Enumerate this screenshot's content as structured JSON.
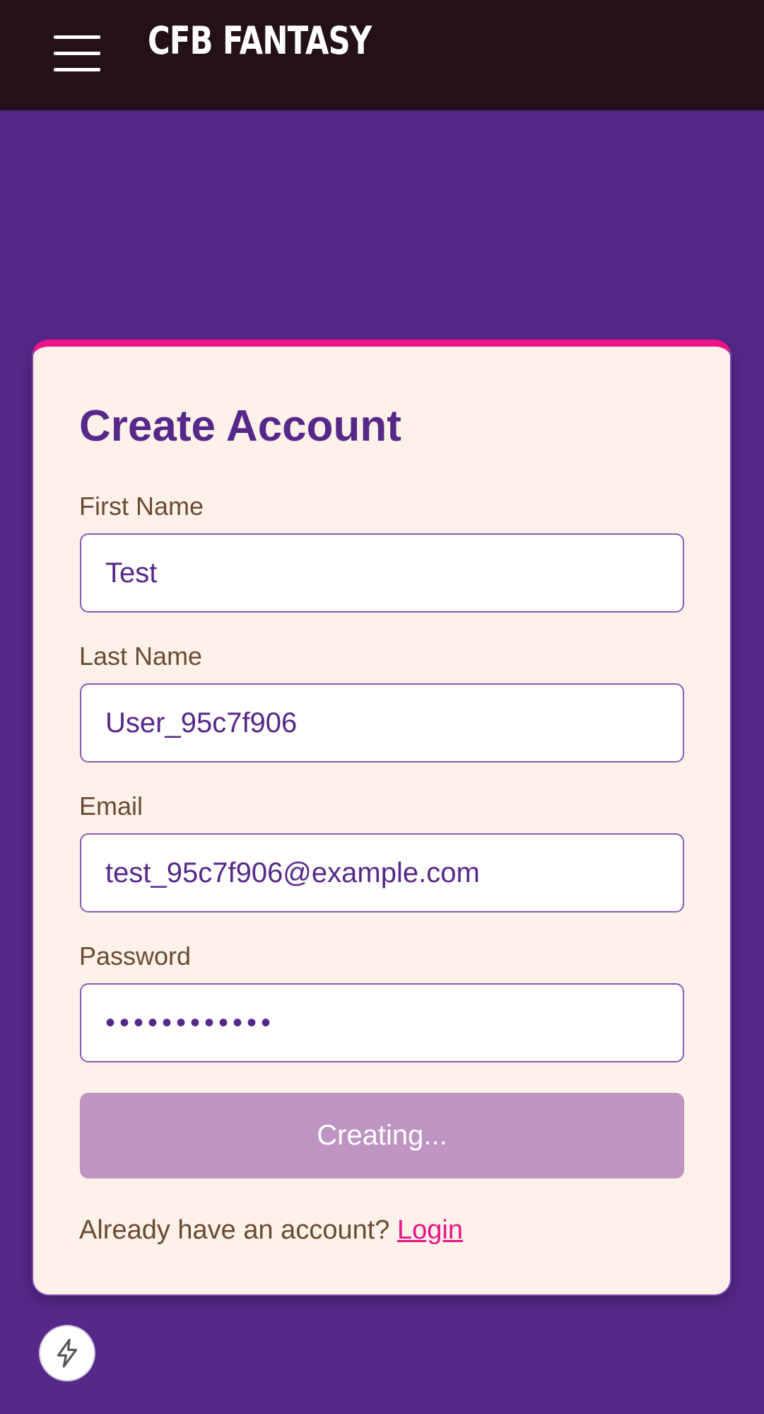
{
  "header": {
    "brand": "CFB FANTASY",
    "menu_icon": "hamburger-menu-icon"
  },
  "form": {
    "title": "Create Account",
    "first_name": {
      "label": "First Name",
      "value": "Test"
    },
    "last_name": {
      "label": "Last Name",
      "value": "User_95c7f906"
    },
    "email": {
      "label": "Email",
      "value": "test_95c7f906@example.com"
    },
    "password": {
      "label": "Password",
      "value": "••••••••••••"
    },
    "submit_label": "Creating...",
    "footer_text": "Already have an account?",
    "login_link": "Login"
  },
  "fab": {
    "icon": "lightning-bolt-icon"
  },
  "colors": {
    "page_bg": "#56288a",
    "header_bg": "#231019",
    "card_bg": "#fdf1ea",
    "accent": "#ec1487",
    "button_disabled": "#be94c2",
    "label_text": "#6b4a32"
  }
}
